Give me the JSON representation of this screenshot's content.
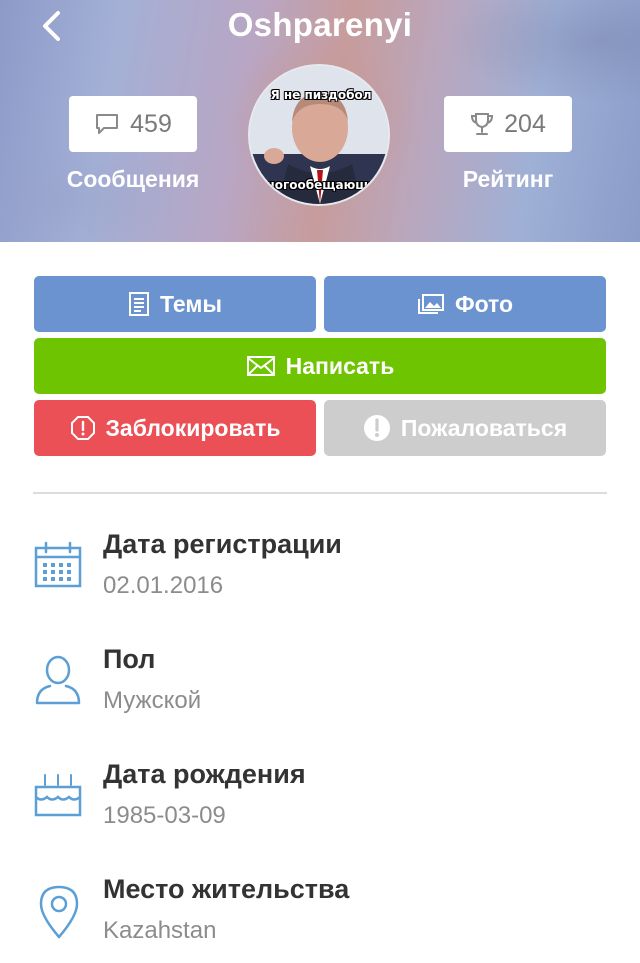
{
  "header": {
    "title": "Oshparenyi",
    "messages_count": "459",
    "messages_label": "Сообщения",
    "rating_count": "204",
    "rating_label": "Рейтинг",
    "avatar": {
      "top_text": "Я не пиздобол",
      "bottom_text": "многообещающий"
    }
  },
  "actions": {
    "topics": "Темы",
    "photos": "Фото",
    "write": "Написать",
    "block": "Заблокировать",
    "report": "Пожаловаться"
  },
  "info": [
    {
      "label": "Дата регистрации",
      "value": "02.01.2016",
      "icon": "calendar-icon"
    },
    {
      "label": "Пол",
      "value": "Мужской",
      "icon": "person-icon"
    },
    {
      "label": "Дата рождения",
      "value": "1985-03-09",
      "icon": "birthday-cake-icon"
    },
    {
      "label": "Место жительства",
      "value": "Kazahstan",
      "icon": "location-pin-icon"
    }
  ],
  "colors": {
    "blue_button": "#6a93cf",
    "green_button": "#6ec400",
    "red_button": "#ea5055",
    "gray_button": "#cdcdcd",
    "icon_blue": "#5b9fd6"
  }
}
